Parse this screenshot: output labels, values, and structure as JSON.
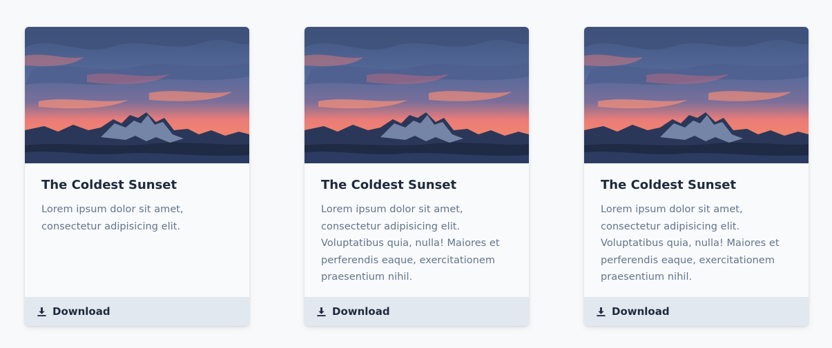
{
  "cards": [
    {
      "image_alt": "Mountain sunset",
      "title": "The Coldest Sunset",
      "text": "Lorem ipsum dolor sit amet, consectetur adipisicing elit.",
      "action_label": "Download",
      "action_icon": "download-icon"
    },
    {
      "image_alt": "Mountain sunset",
      "title": "The Coldest Sunset",
      "text": "Lorem ipsum dolor sit amet, consectetur adipisicing elit. Voluptatibus quia, nulla! Maiores et perferendis eaque, exercitationem praesentium nihil.",
      "action_label": "Download",
      "action_icon": "download-icon"
    },
    {
      "image_alt": "Mountain sunset",
      "title": "The Coldest Sunset",
      "text": "Lorem ipsum dolor sit amet, consectetur adipisicing elit. Voluptatibus quia, nulla! Maiores et perferendis eaque, exercitationem praesentium nihil.",
      "action_label": "Download",
      "action_icon": "download-icon"
    }
  ],
  "colors": {
    "page_background": "#f8f9fb",
    "card_background": "#f8fafc",
    "footer_background": "#e2e8f0",
    "title": "#1e293b",
    "body_text": "#64748b",
    "sky_top": "#4a5f8f",
    "sunset_glow": "#f07a72",
    "mountain": "#1f2a45"
  }
}
